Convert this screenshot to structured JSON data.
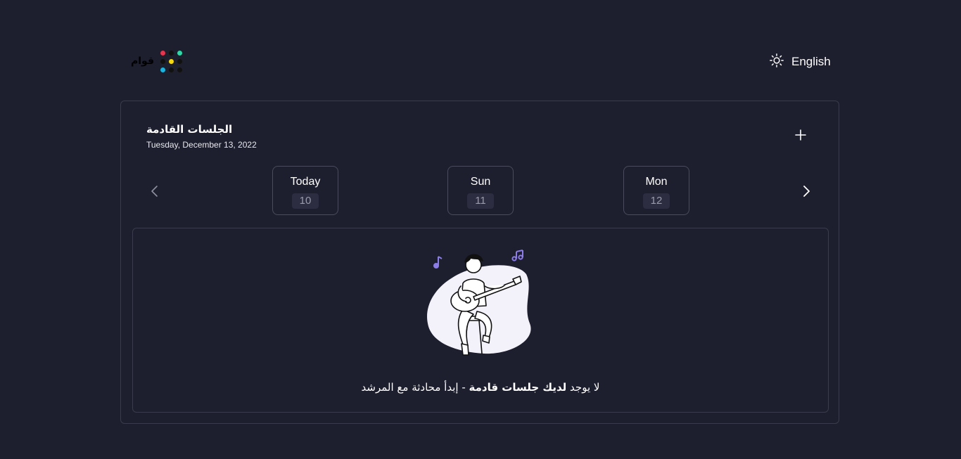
{
  "header": {
    "logo_text": "قوام",
    "language_label": "English"
  },
  "sessions": {
    "title": "الجلسات القادمة",
    "date": "Tuesday, December 13, 2022",
    "days": [
      {
        "name": "Today",
        "number": "10"
      },
      {
        "name": "Sun",
        "number": "11"
      },
      {
        "name": "Mon",
        "number": "12"
      }
    ],
    "empty_message": {
      "part1": "لا يوجد ",
      "bold": "لديك جلسات قادمة",
      "part2": " - إبدأ محادثة مع المرشد"
    }
  },
  "colors": {
    "background": "#1d1e2e",
    "border": "#3a3b4c",
    "logo_red": "#e8344e",
    "logo_green": "#2ed8a8",
    "logo_yellow": "#f5d90a",
    "logo_blue": "#19b4e0",
    "note_purple": "#8c7ce8"
  },
  "icons": {
    "theme_toggle": "sun-icon",
    "add": "plus-icon",
    "prev": "chevron-left-icon",
    "next": "chevron-right-icon"
  }
}
